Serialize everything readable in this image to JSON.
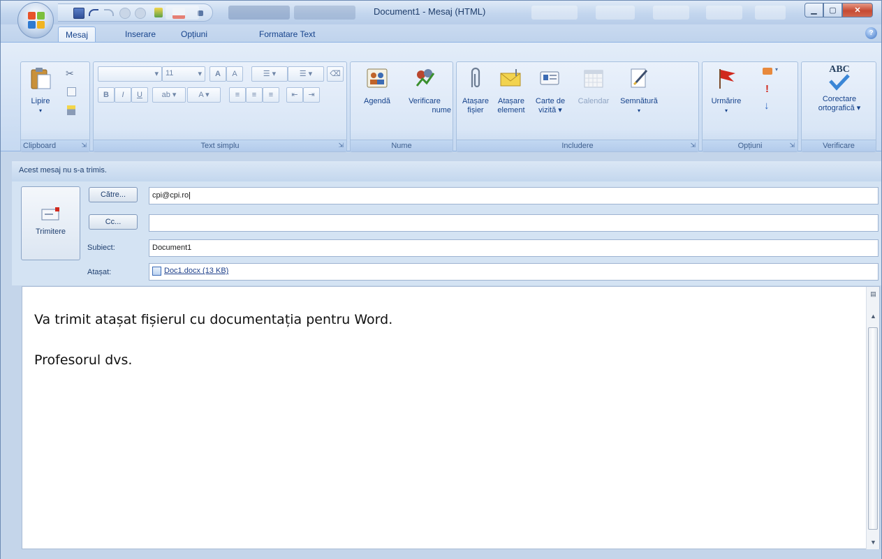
{
  "window": {
    "title": "Document1 - Mesaj (HTML)",
    "controls": [
      "minimize",
      "maximize",
      "close"
    ]
  },
  "tabs": [
    {
      "label": "Mesaj",
      "active": true
    },
    {
      "label": "Inserare",
      "active": false
    },
    {
      "label": "Opțiuni",
      "active": false
    },
    {
      "label": "Formatare Text",
      "active": false
    }
  ],
  "ribbon": {
    "clipboard": {
      "label": "Clipboard",
      "paste": "Lipire"
    },
    "text": {
      "label": "Text simplu",
      "font_size": "11"
    },
    "names": {
      "label": "Nume",
      "address_book": "Agendă",
      "check_names_1": "Verificare",
      "check_names_2": "nume"
    },
    "include": {
      "label": "Includere",
      "attach_file_1": "Atașare",
      "attach_file_2": "fișier",
      "attach_item_1": "Atașare",
      "attach_item_2": "element",
      "business_card_1": "Carte de",
      "business_card_2": "vizită ▾",
      "calendar": "Calendar",
      "signature": "Semnătură"
    },
    "options": {
      "label": "Opțiuni",
      "follow_up": "Urmărire"
    },
    "proofing": {
      "label": "Verificare",
      "spelling_1": "Corectare",
      "spelling_2": "ortografică ▾",
      "abc": "ABC"
    }
  },
  "form": {
    "info": "Acest mesaj nu s-a trimis.",
    "send": "Trimitere",
    "to_button": "Către...",
    "cc_button": "Cc...",
    "subject_label": "Subiect:",
    "attach_label": "Atașat:",
    "to_value": "cpi@cpi.ro",
    "cc_value": "",
    "subject_value": "Document1",
    "attachment": "Doc1.docx (13 KB)"
  },
  "body": {
    "line1": "Va trimit atașat fișierul cu documentația pentru Word.",
    "line2": "Profesorul dvs."
  },
  "colors": {
    "frame": "#c4d5ea",
    "ribbon_text": "#15428b",
    "flag": "#d0291e"
  }
}
